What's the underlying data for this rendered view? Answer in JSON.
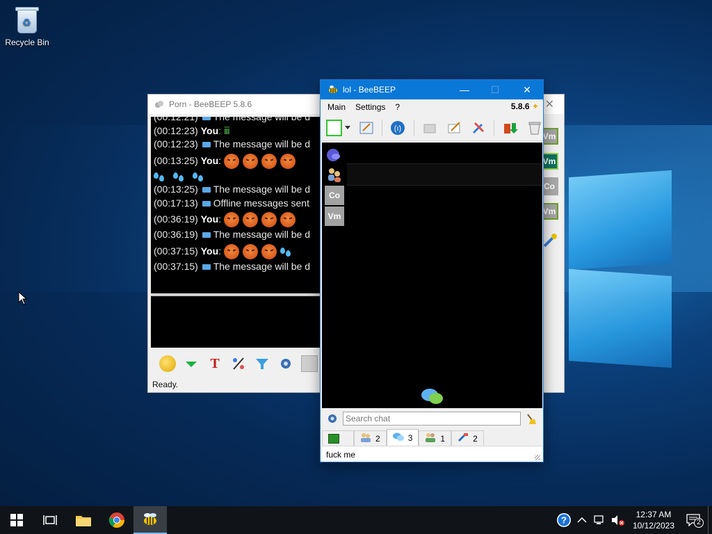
{
  "desktop": {
    "icons": [
      {
        "label": "Recycle Bin",
        "icon": "recycle-bin-icon"
      }
    ]
  },
  "back_window": {
    "title": "Porn - BeeBEEP 5.8.6",
    "close_glyph": "✕",
    "log": [
      {
        "time": "(00:12:21)",
        "kind": "system",
        "text": "The message will be d"
      },
      {
        "time": "(00:12:23)",
        "kind": "you",
        "sender": "You",
        "text": ": ⅲ"
      },
      {
        "time": "(00:12:23)",
        "kind": "system",
        "text": "The message will be d"
      },
      {
        "time": "(00:13:25)",
        "kind": "you",
        "sender": "You",
        "text": ":"
      },
      {
        "time": "(00:13:25)",
        "kind": "system",
        "text": "The message will be d"
      },
      {
        "time": "(00:17:13)",
        "kind": "system",
        "text": "Offline messages sent"
      },
      {
        "time": "(00:36:19)",
        "kind": "you",
        "sender": "You",
        "text": ":"
      },
      {
        "time": "(00:36:19)",
        "kind": "system",
        "text": "The message will be d"
      },
      {
        "time": "(00:37:15)",
        "kind": "you",
        "sender": "You",
        "text": ":"
      },
      {
        "time": "(00:37:15)",
        "kind": "system",
        "text": "The message will be d"
      }
    ],
    "status_text": "Ready.",
    "side_users": [
      "Vm",
      "Vm",
      "Co",
      "Vm"
    ]
  },
  "front_window": {
    "title": "lol - BeeBEEP",
    "controls": {
      "minimize": "—",
      "maximize": "☐",
      "close": "✕"
    },
    "menu": [
      "Main",
      "Settings",
      "?"
    ],
    "version": "5.8.6",
    "users": [
      "Co",
      "Vm"
    ],
    "search_placeholder": "Search chat",
    "tabs": [
      {
        "icon": "monitor-icon",
        "count": ""
      },
      {
        "icon": "users-icon",
        "count": "2"
      },
      {
        "icon": "chat-icon",
        "count": "3"
      },
      {
        "icon": "group-icon",
        "count": "1"
      },
      {
        "icon": "share-icon",
        "count": "2"
      }
    ],
    "bottom_text": "fuck me"
  },
  "taskbar": {
    "time": "12:37 AM",
    "date": "10/12/2023",
    "notifications": "2"
  }
}
